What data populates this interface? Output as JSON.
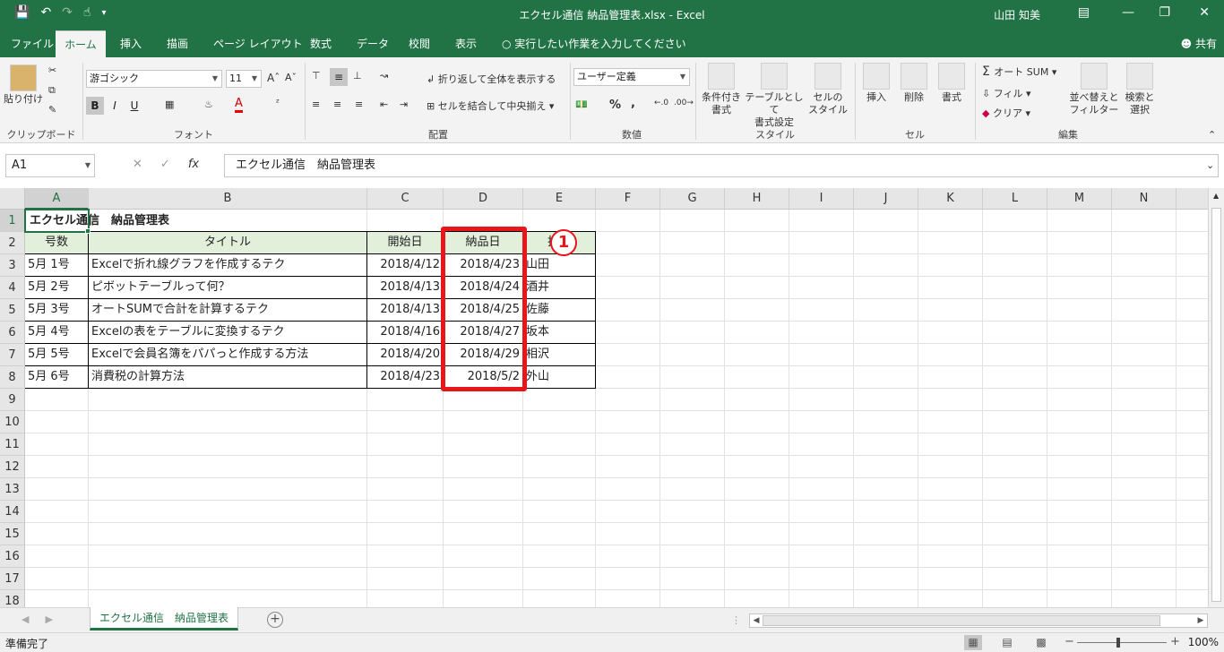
{
  "titlebar": {
    "title": "エクセル通信 納品管理表.xlsx  -  Excel",
    "user": "山田 知美",
    "icons": [
      "save-icon",
      "undo-icon",
      "redo-icon",
      "touch-mode-icon",
      "customize-icon"
    ]
  },
  "tabs": [
    "ファイル",
    "ホーム",
    "挿入",
    "描画",
    "ページ レイアウト",
    "数式",
    "データ",
    "校閲",
    "表示"
  ],
  "active_tab": "ホーム",
  "tell_me": "実行したい作業を入力してください",
  "share": "共有",
  "ribbon": {
    "clipboard": {
      "paste": "貼り付け",
      "label": "クリップボード"
    },
    "font": {
      "name": "游ゴシック",
      "size": "11",
      "label": "フォント",
      "bold": "B",
      "italic": "I",
      "underline": "U"
    },
    "alignment": {
      "wrap": "折り返して全体を表示する",
      "merge": "セルを結合して中央揃え",
      "label": "配置"
    },
    "number": {
      "format": "ユーザー定義",
      "percent": "%",
      "comma": ",",
      "label": "数値"
    },
    "styles": {
      "conditional": "条件付き\n書式",
      "table": "テーブルとして\n書式設定",
      "cell": "セルの\nスタイル",
      "label": "スタイル"
    },
    "cells": {
      "insert": "挿入",
      "delete": "削除",
      "format": "書式",
      "label": "セル"
    },
    "editing": {
      "autosum": "オート SUM",
      "fill": "フィル",
      "clear": "クリア",
      "sort": "並べ替えと\nフィルター",
      "find": "検索と\n選択",
      "label": "編集"
    }
  },
  "formula_bar": {
    "name_box": "A1",
    "formula": "エクセル通信　納品管理表"
  },
  "columns": [
    "A",
    "B",
    "C",
    "D",
    "E",
    "F",
    "G",
    "H",
    "I",
    "J",
    "K",
    "L",
    "M",
    "N"
  ],
  "rows": [
    "1",
    "2",
    "3",
    "4",
    "5",
    "6",
    "7",
    "8",
    "9",
    "10",
    "11",
    "12",
    "13",
    "14",
    "15",
    "16",
    "17",
    "18"
  ],
  "sheet": {
    "title": "エクセル通信　納品管理表",
    "headers": [
      "号数",
      "タイトル",
      "開始日",
      "納品日",
      "担当"
    ],
    "data": [
      [
        "5月 1号",
        "Excelで折れ線グラフを作成するテク",
        "2018/4/12",
        "2018/4/23",
        "山田"
      ],
      [
        "5月 2号",
        "ピボットテーブルって何？",
        "2018/4/13",
        "2018/4/24",
        "酒井"
      ],
      [
        "5月 3号",
        "オートSUMで合計を計算するテク",
        "2018/4/13",
        "2018/4/25",
        "佐藤"
      ],
      [
        "5月 4号",
        "Excelの表をテーブルに変換するテク",
        "2018/4/16",
        "2018/4/27",
        "坂本"
      ],
      [
        "5月 5号",
        "Excelで会員名簿をパパっと作成する方法",
        "2018/4/20",
        "2018/4/29",
        "相沢"
      ],
      [
        "5月 6号",
        "消費税の計算方法",
        "2018/4/23",
        "2018/5/2",
        "外山"
      ]
    ]
  },
  "annotation": {
    "badge": "1",
    "color": "#e8161a"
  },
  "sheet_tab": "エクセル通信　納品管理表",
  "status": "準備完了",
  "zoom": "100%",
  "accent": "#217346"
}
